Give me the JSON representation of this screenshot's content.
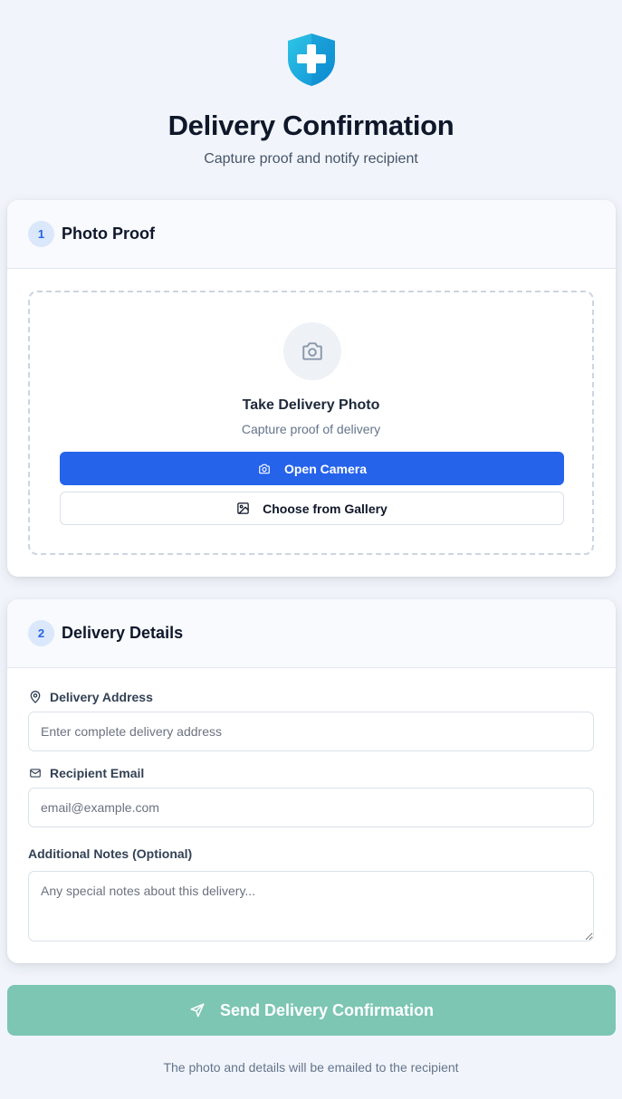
{
  "header": {
    "logo_icon": "shield-plus-icon",
    "title": "Delivery Confirmation",
    "subtitle": "Capture proof and notify recipient"
  },
  "photo_section": {
    "step": "1",
    "title": "Photo Proof",
    "camera_icon": "camera-icon",
    "dropzone_title": "Take Delivery Photo",
    "dropzone_subtitle": "Capture proof of delivery",
    "open_camera_label": "Open Camera",
    "gallery_label": "Choose from Gallery"
  },
  "details_section": {
    "step": "2",
    "title": "Delivery Details",
    "address": {
      "label": "Delivery Address",
      "icon": "map-pin-icon",
      "placeholder": "Enter complete delivery address",
      "value": ""
    },
    "email": {
      "label": "Recipient Email",
      "icon": "mail-icon",
      "placeholder": "email@example.com",
      "value": ""
    },
    "notes": {
      "label": "Additional Notes (Optional)",
      "placeholder": "Any special notes about this delivery...",
      "value": ""
    }
  },
  "send": {
    "label": "Send Delivery Confirmation",
    "icon": "send-icon",
    "footnote": "The photo and details will be emailed to the recipient"
  },
  "colors": {
    "accent": "#2563eb",
    "send_button": "#7cc6b3",
    "background": "#f1f5fb"
  }
}
